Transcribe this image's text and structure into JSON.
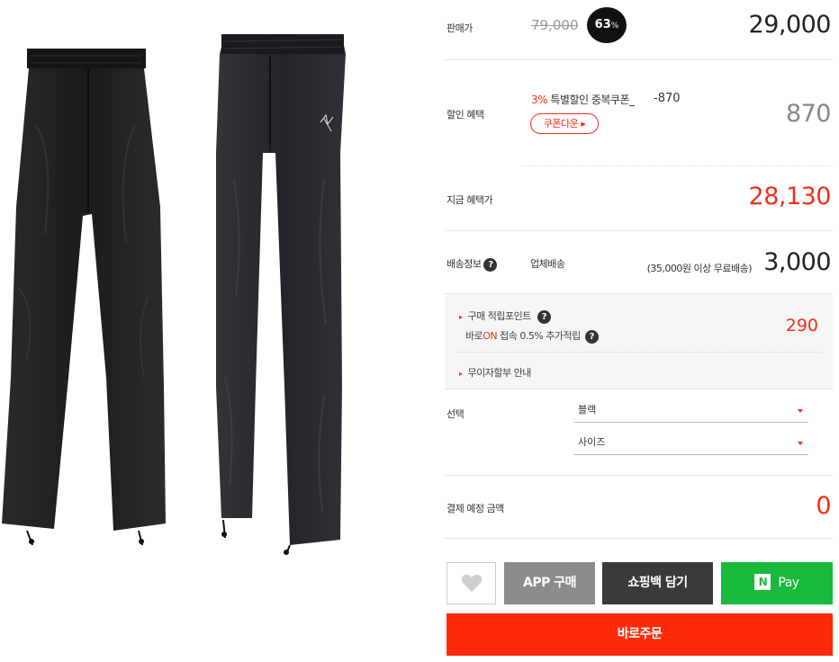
{
  "price": {
    "label": "판매가",
    "original": "79,000",
    "rate": "63",
    "rate_unit": "%",
    "sale": "29,000"
  },
  "discount": {
    "label": "할인 혜택",
    "coupon_pct": "3%",
    "coupon_name": " 특별할인 중복쿠폰_",
    "coupon_amount": "-870",
    "coupon_button": "쿠폰다운 ▸",
    "total": "870"
  },
  "benefit_price": {
    "label": "지금 혜택가",
    "value": "28,130"
  },
  "shipping": {
    "label": "배송정보",
    "help": "?",
    "type": "업체배송",
    "free_note": "(35,000원 이상 무료배송)",
    "fee": "3,000"
  },
  "points": {
    "arrow": "▸",
    "label": "구매 적립포인트",
    "help": "?",
    "app_prefix": "바로",
    "app_on": "ON",
    "app_suffix": " 접속 0.5% 추가적립",
    "value": "290",
    "installment_label": "무이자할부 안내"
  },
  "options": {
    "label": "선택",
    "color_value": "블랙",
    "size_value": "사이즈"
  },
  "total": {
    "label": "결제 예정 금액",
    "value": "0"
  },
  "buttons": {
    "app": "APP 구매",
    "cart": "쇼핑백 담기",
    "npay_logo": "N",
    "npay": "Pay",
    "order": "바로주문"
  },
  "colors": {
    "accent_red": "#f0301c",
    "order_red": "#ff2a0a",
    "npay_green": "#19b93c"
  }
}
